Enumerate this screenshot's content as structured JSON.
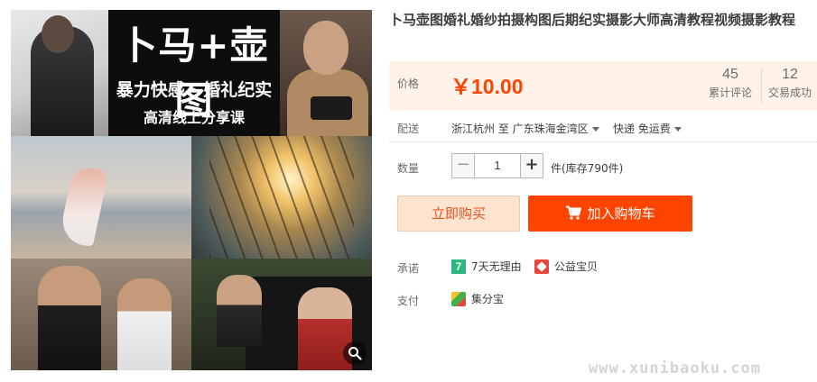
{
  "gallery": {
    "banner_title": "卜马+壶图",
    "banner_line1": "暴力快感 · 婚礼纪实",
    "banner_line2": "高清线上分享课",
    "zoom_icon": "zoom-icon"
  },
  "product": {
    "title": "卜马壶图婚礼婚纱拍摄构图后期纪实摄影大师高清教程视频摄影教程"
  },
  "price": {
    "label": "价格",
    "value": "￥10.00",
    "reviews_count": "45",
    "reviews_label": "累计评论",
    "sold_count": "12",
    "sold_label": "交易成功"
  },
  "shipping": {
    "label": "配送",
    "from": "浙江杭州 至",
    "to": "广东珠海金湾区",
    "method": "快递 免运费"
  },
  "quantity": {
    "label": "数量",
    "value": "1",
    "minus": "−",
    "plus": "+",
    "stock": "件(库存790件)"
  },
  "actions": {
    "buy_now": "立即购买",
    "add_to_cart": "加入购物车"
  },
  "promise": {
    "label": "承诺",
    "return_icon_text": "7",
    "return_policy": "7天无理由",
    "charity": "公益宝贝"
  },
  "payment": {
    "label": "支付",
    "method": "集分宝"
  },
  "watermark": "www.xunibaoku.com",
  "colors": {
    "accent": "#ff4400",
    "price_bg": "#fff2e8",
    "buy_bg": "#ffe4d0"
  }
}
